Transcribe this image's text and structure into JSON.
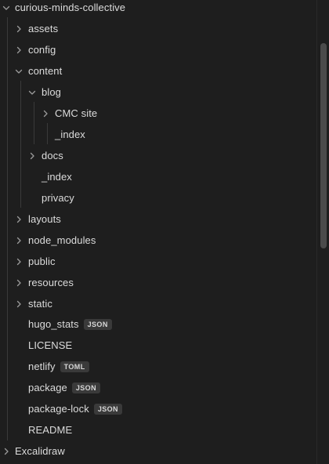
{
  "tree": {
    "root": {
      "label": "curious-minds-collective",
      "expanded": true
    },
    "items": [
      {
        "label": "assets",
        "expanded": false
      },
      {
        "label": "config",
        "expanded": false
      },
      {
        "label": "content",
        "expanded": true
      },
      {
        "label": "blog",
        "expanded": true
      },
      {
        "label": "CMC site",
        "expanded": false
      },
      {
        "label": "_index"
      },
      {
        "label": "docs",
        "expanded": false
      },
      {
        "label": "_index"
      },
      {
        "label": "privacy"
      },
      {
        "label": "layouts",
        "expanded": false
      },
      {
        "label": "node_modules",
        "expanded": false
      },
      {
        "label": "public",
        "expanded": false
      },
      {
        "label": "resources",
        "expanded": false
      },
      {
        "label": "static",
        "expanded": false
      },
      {
        "label": "hugo_stats",
        "badge": "JSON"
      },
      {
        "label": "LICENSE"
      },
      {
        "label": "netlify",
        "badge": "TOML"
      },
      {
        "label": "package",
        "badge": "JSON"
      },
      {
        "label": "package-lock",
        "badge": "JSON"
      },
      {
        "label": "README"
      }
    ],
    "sibling_root": {
      "label": "Excalidraw",
      "expanded": false
    }
  },
  "colors": {
    "background": "#1e1e1e",
    "text": "#dcdcdc",
    "chevron": "#9a9a9a",
    "badge_bg": "#3a3a3a",
    "guide": "#3a3a3a",
    "scrollbar_thumb": "#4b4b4b"
  }
}
